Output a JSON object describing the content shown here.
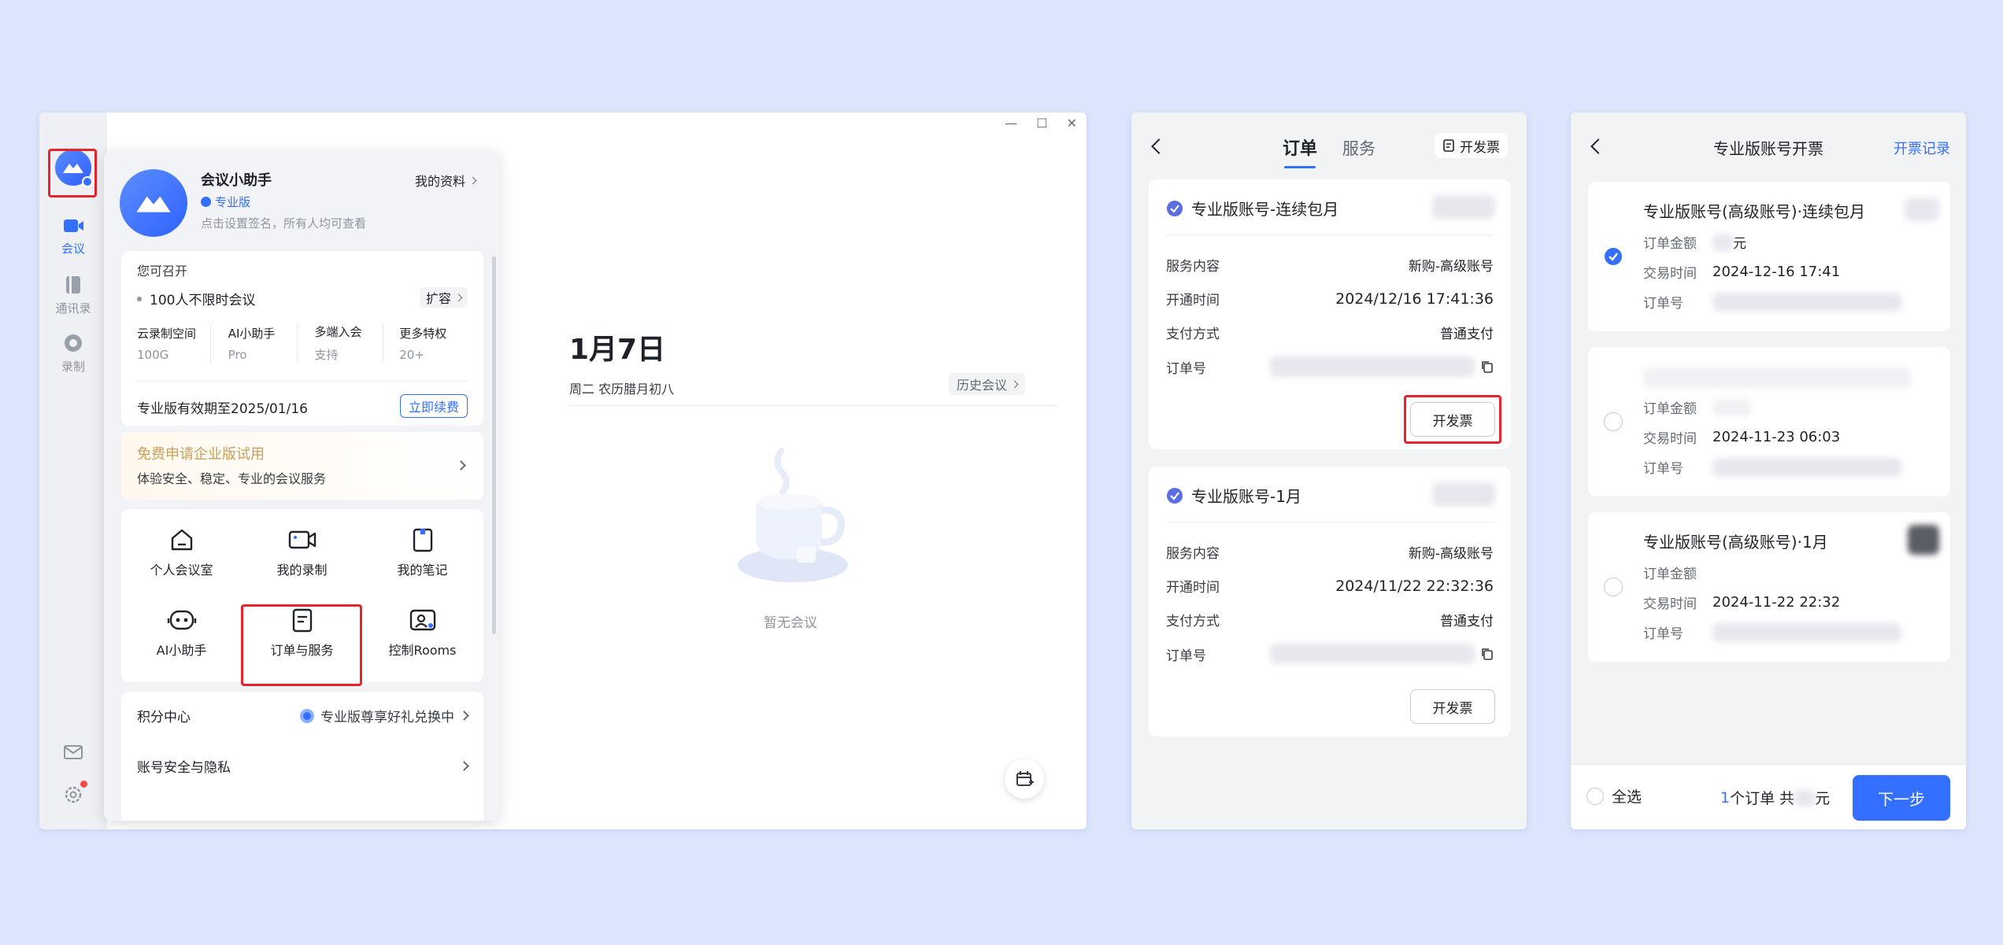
{
  "app_window": {
    "window_controls": [
      "—",
      "☐",
      "✕"
    ],
    "rail": {
      "items": [
        {
          "label": "会议",
          "icon": "video-icon",
          "active": true
        },
        {
          "label": "通讯录",
          "icon": "contacts-icon",
          "active": false
        },
        {
          "label": "录制",
          "icon": "record-icon",
          "active": false
        }
      ]
    },
    "profile": {
      "name": "会议小助手",
      "my_profile": "我的资料",
      "badge": "专业版",
      "signature": "点击设置签名，所有人均可查看",
      "can_host": "您可召开",
      "meeting_limit": "100人不限时会议",
      "expand": "扩容",
      "stats": [
        {
          "label": "云录制空间",
          "value": "100G"
        },
        {
          "label": "AI小助手",
          "value": "Pro"
        },
        {
          "label": "多端入会",
          "value": "支持"
        },
        {
          "label": "更多特权",
          "value": "20+"
        }
      ],
      "expiry": "专业版有效期至2025/01/16",
      "renew": "立即续费",
      "trial_title": "免费申请企业版试用",
      "trial_desc": "体验安全、稳定、专业的会议服务",
      "grid": [
        {
          "label": "个人会议室",
          "icon": "home-icon"
        },
        {
          "label": "我的录制",
          "icon": "recording-icon"
        },
        {
          "label": "我的笔记",
          "icon": "notes-icon"
        },
        {
          "label": "AI小助手",
          "icon": "ai-robot-icon"
        },
        {
          "label": "订单与服务",
          "icon": "order-icon"
        },
        {
          "label": "控制Rooms",
          "icon": "rooms-icon"
        }
      ],
      "points_center": "积分中心",
      "points_promo": "专业版尊享好礼兑换中",
      "security": "账号安全与隐私"
    },
    "main": {
      "date": "1月7日",
      "subdate": "周二 农历腊月初八",
      "history": "历史会议",
      "empty": "暂无会议"
    }
  },
  "orders_window": {
    "tabs": [
      "订单",
      "服务"
    ],
    "invoice_button": "开发票",
    "orders": [
      {
        "title": "专业版账号-连续包月",
        "rows": [
          {
            "label": "服务内容",
            "value": "新购-高级账号"
          },
          {
            "label": "开通时间",
            "value": "2024/12/16 17:41:36"
          },
          {
            "label": "支付方式",
            "value": "普通支付"
          },
          {
            "label": "订单号",
            "value": ""
          }
        ],
        "action": "开发票"
      },
      {
        "title": "专业版账号-1月",
        "rows": [
          {
            "label": "服务内容",
            "value": "新购-高级账号"
          },
          {
            "label": "开通时间",
            "value": "2024/11/22 22:32:36"
          },
          {
            "label": "支付方式",
            "value": "普通支付"
          },
          {
            "label": "订单号",
            "value": ""
          }
        ],
        "action": "开发票"
      }
    ]
  },
  "invoice_window": {
    "title": "专业版账号开票",
    "records": "开票记录",
    "items": [
      {
        "title": "专业版账号(高级账号)·连续包月",
        "amount_label": "订单金额",
        "amount_suffix": "元",
        "time_label": "交易时间",
        "time": "2024-12-16 17:41",
        "order_label": "订单号",
        "checked": true
      },
      {
        "title": "",
        "amount_label": "订单金额",
        "amount_suffix": "",
        "time_label": "交易时间",
        "time": "2024-11-23 06:03",
        "order_label": "订单号",
        "checked": false
      },
      {
        "title": "专业版账号(高级账号)·1月",
        "amount_label": "订单金额",
        "amount_suffix": "",
        "time_label": "交易时间",
        "time": "2024-11-22 22:32",
        "order_label": "订单号",
        "checked": false
      }
    ],
    "select_all": "全选",
    "summary_count": "1",
    "summary_mid": "个订单 共",
    "summary_suffix": "元",
    "next": "下一步"
  },
  "colors": {
    "accent": "#3370ff",
    "highlight": "#e5242b",
    "gold": "#c9a05a",
    "background": "#dce5fc"
  }
}
